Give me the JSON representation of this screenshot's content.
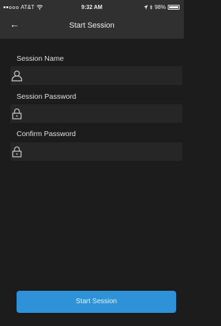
{
  "status_bar": {
    "carrier": "AT&T",
    "time": "9:32 AM",
    "battery": "98%",
    "battery_level": 0.98
  },
  "nav": {
    "back_icon": "arrow-left-icon",
    "title": "Start Session"
  },
  "form": {
    "session_name": {
      "label": "Session Name",
      "icon": "user-icon",
      "value": ""
    },
    "session_password": {
      "label": "Session Password",
      "icon": "lock-icon",
      "value": ""
    },
    "confirm_password": {
      "label": "Confirm Password",
      "icon": "lock-icon",
      "value": ""
    }
  },
  "actions": {
    "start_label": "Start Session"
  },
  "colors": {
    "background": "#1c1c1c",
    "bar": "#303030",
    "field": "#262626",
    "accent": "#2f92d8"
  }
}
